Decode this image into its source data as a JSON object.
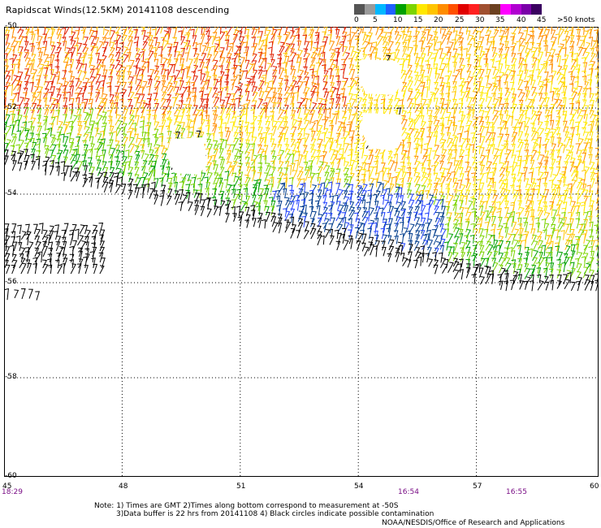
{
  "title": "Rapidscat Winds(12.5KM) 20141108 descending",
  "scale": {
    "labels": [
      "0",
      "5",
      "10",
      "15",
      "20",
      "25",
      "30",
      "35",
      "40",
      "45",
      ">50 knots"
    ],
    "colors": [
      "#555555",
      "#9a9a9a",
      "#00b8ff",
      "#1f60ff",
      "#00a000",
      "#7cd400",
      "#ffe800",
      "#ffc400",
      "#ff8c00",
      "#ff5000",
      "#e00000",
      "#ff2020",
      "#a05030",
      "#6b4020",
      "#ff00ff",
      "#b000d0",
      "#7a00a8",
      "#3a0060"
    ]
  },
  "axes": {
    "lat_labels": [
      "-50",
      "-52",
      "-54",
      "-56",
      "-58",
      "-60"
    ],
    "lon_labels": [
      "45",
      "48",
      "51",
      "54",
      "57",
      "60"
    ],
    "time_labels": [
      "18:29",
      "16:54",
      "16:55"
    ]
  },
  "notes": {
    "line1": "Note: 1) Times are GMT 2)Times along bottom correspond to measurement at -50S",
    "line2": "3)Data buffer is 22 hrs from 20141108 4) Black circles indicate possible contamination",
    "credit": "NOAA/NESDIS/Office of Research and Applications"
  }
}
